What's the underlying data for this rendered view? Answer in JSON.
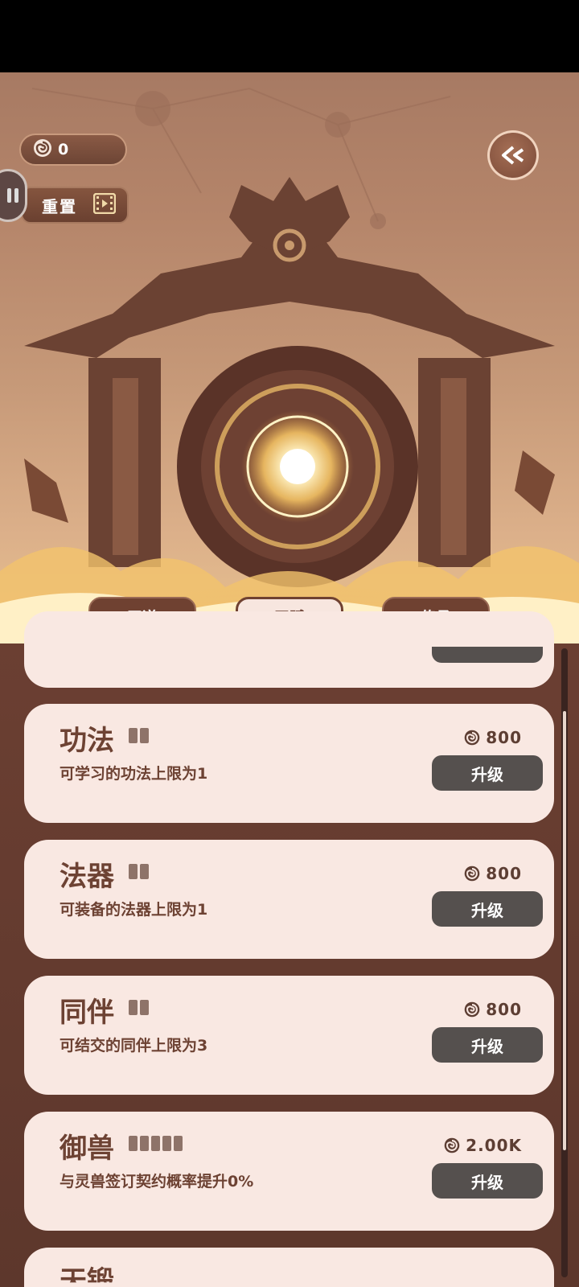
{
  "currency": {
    "amount": "0",
    "icon": "swirl-coin-icon"
  },
  "reset": {
    "label": "重置",
    "icon": "video-ad-icon"
  },
  "tabs": [
    {
      "label": "天道",
      "active": false
    },
    {
      "label": "天赋",
      "active": true
    },
    {
      "label": "传承",
      "active": false
    }
  ],
  "talents": [
    {
      "title": "功法",
      "level_pips": 2,
      "desc": "可学习的功法上限为1",
      "cost": "800",
      "button": "升级"
    },
    {
      "title": "法器",
      "level_pips": 2,
      "desc": "可装备的法器上限为1",
      "cost": "800",
      "button": "升级"
    },
    {
      "title": "同伴",
      "level_pips": 2,
      "desc": "可结交的同伴上限为3",
      "cost": "800",
      "button": "升级"
    },
    {
      "title": "御兽",
      "level_pips": 5,
      "desc": "与灵兽签订契约概率提升0%",
      "cost": "2.00K",
      "button": "升级"
    }
  ],
  "partial_bottom_card": {
    "title": "天锻"
  },
  "colors": {
    "brown": "#6f4131",
    "card": "#f9e8e2",
    "button": "#55504e"
  }
}
